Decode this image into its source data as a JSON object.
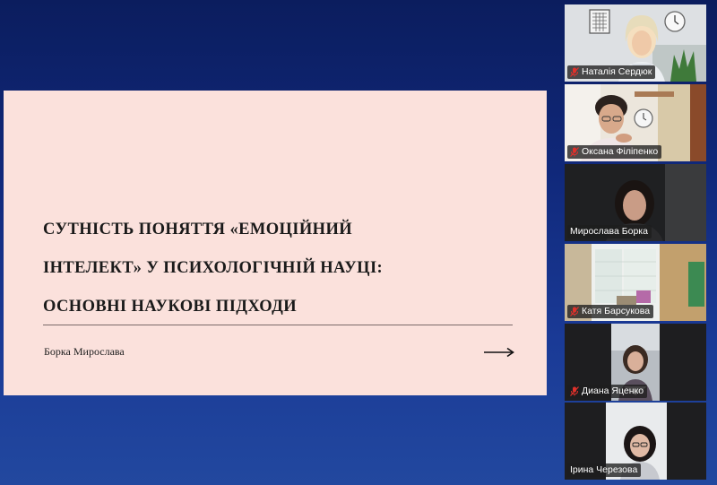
{
  "slide": {
    "title_lines": [
      "СУТНІСТЬ ПОНЯТТЯ «ЕМОЦІЙНИЙ",
      "ІНТЕЛЕКТ» У ПСИХОЛОГІЧНІЙ НАУЦІ:",
      "ОСНОВНІ НАУКОВІ ПІДХОДИ"
    ],
    "author": "Борка Мирослава",
    "next_icon": "arrow-right-icon",
    "background_color": "#fbe1dc"
  },
  "participants": [
    {
      "name": "Наталія Сердюк",
      "muted": true,
      "speaking": false
    },
    {
      "name": "Оксана Філіпенко",
      "muted": true,
      "speaking": false
    },
    {
      "name": "Мирослава Борка",
      "muted": false,
      "speaking": true
    },
    {
      "name": "Катя Барсукова",
      "muted": true,
      "speaking": false
    },
    {
      "name": "Диана Яценко",
      "muted": true,
      "speaking": false
    },
    {
      "name": "Ірина Черезова",
      "muted": false,
      "speaking": false
    }
  ],
  "colors": {
    "speaking_border": "#37d67a",
    "muted_icon": "#e0312b",
    "background_top": "#0b1d5e",
    "background_bottom": "#22489f"
  }
}
